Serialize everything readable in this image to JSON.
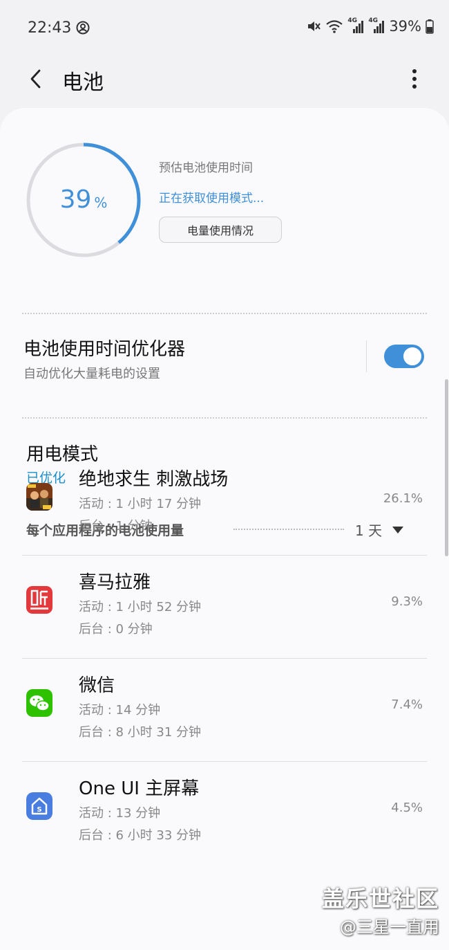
{
  "status_bar": {
    "time": "22:43",
    "battery_text": "39%",
    "net_label_1": "4G",
    "net_label_2": "4G"
  },
  "header": {
    "title": "电池"
  },
  "battery": {
    "level_number": "39",
    "level_unit": "%",
    "level_fraction": 0.39,
    "estimate_label": "预估电池使用时间",
    "estimate_status": "正在获取使用模式...",
    "usage_button_label": "电量使用情况"
  },
  "optimizer": {
    "title": "电池使用时间优化器",
    "subtitle": "自动优化大量耗电的设置",
    "enabled": true
  },
  "power_mode": {
    "title": "用电模式",
    "value": "已优化"
  },
  "usage": {
    "header": "每个应用程序的电池使用量",
    "period": "1 天",
    "apps": [
      {
        "name": "绝地求生 刺激战场",
        "active": "活动 : 1 小时 17 分钟",
        "background": "后台 : 1 分钟",
        "percent": "26.1%",
        "icon": "game-icon"
      },
      {
        "name": "喜马拉雅",
        "active": "活动 : 1 小时 52 分钟",
        "background": "后台 : 0 分钟",
        "percent": "9.3%",
        "icon": "ximalaya-icon"
      },
      {
        "name": "微信",
        "active": "活动 : 14 分钟",
        "background": "后台 : 8 小时 31 分钟",
        "percent": "7.4%",
        "icon": "wechat-icon"
      },
      {
        "name": "One UI 主屏幕",
        "active": "活动 : 13 分钟",
        "background": "后台 : 6 小时 33 分钟",
        "percent": "4.5%",
        "icon": "home-launcher-icon"
      }
    ]
  },
  "watermark": {
    "line1": "盖乐世社区",
    "line2": "@三星一直用"
  },
  "colors": {
    "accent": "#3f8fd9",
    "mode_value": "#1c8fc9",
    "background": "#f2f2f5"
  }
}
